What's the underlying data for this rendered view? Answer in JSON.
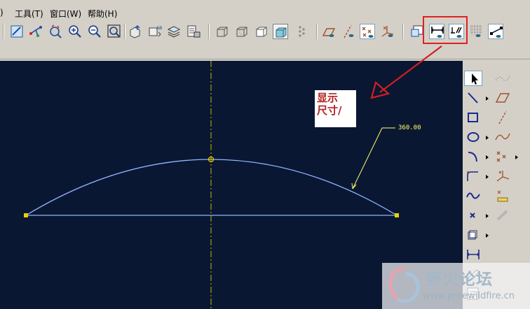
{
  "menu": {
    "items": [
      {
        "label": ")"
      },
      {
        "label": "工具(T)"
      },
      {
        "label": "窗口(W)"
      },
      {
        "label": "帮助(H)"
      }
    ]
  },
  "toolbar": {
    "icons": [
      "sketch-icon",
      "datum-tool-icon",
      "refit-icon",
      "zoom-in-icon",
      "zoom-out-icon",
      "zoom-window-icon",
      "orient-icon",
      "saved-views-icon",
      "layers-icon",
      "view-manager-icon",
      "wireframe-icon",
      "hidden-line-icon",
      "no-hidden-icon",
      "shading-icon",
      "model-tree-icon",
      "datum-plane-display-icon",
      "datum-axis-display-icon",
      "point-display-icon",
      "csys-display-icon",
      "sketcher-toggle-icon",
      "dimension-display-icon",
      "constraint-display-icon",
      "grid-display-icon",
      "vertex-display-icon"
    ]
  },
  "annotation": {
    "line1": "显示",
    "line2": "尺寸/",
    "text_color": "#b22020",
    "highlight_color": "#e02020"
  },
  "dimension": {
    "label": "360.00",
    "color": "#ffff66"
  },
  "colors": {
    "canvas": "#0a1733",
    "sketch_geometry": "#8fb4ff",
    "centerline": "#c8b400"
  },
  "sidebar": {
    "tools": [
      "select-icon",
      "centerline-icon",
      "line-icon",
      "rectangle-icon",
      "circle-icon",
      "arc-icon",
      "fillet-icon",
      "spline-icon",
      "point-icon",
      "offset-edge-icon",
      "dimension-icon",
      "modify-icon",
      "constraints-icon"
    ]
  },
  "watermark": {
    "title": "野火论坛",
    "url": "www.proewildfire.cn"
  }
}
